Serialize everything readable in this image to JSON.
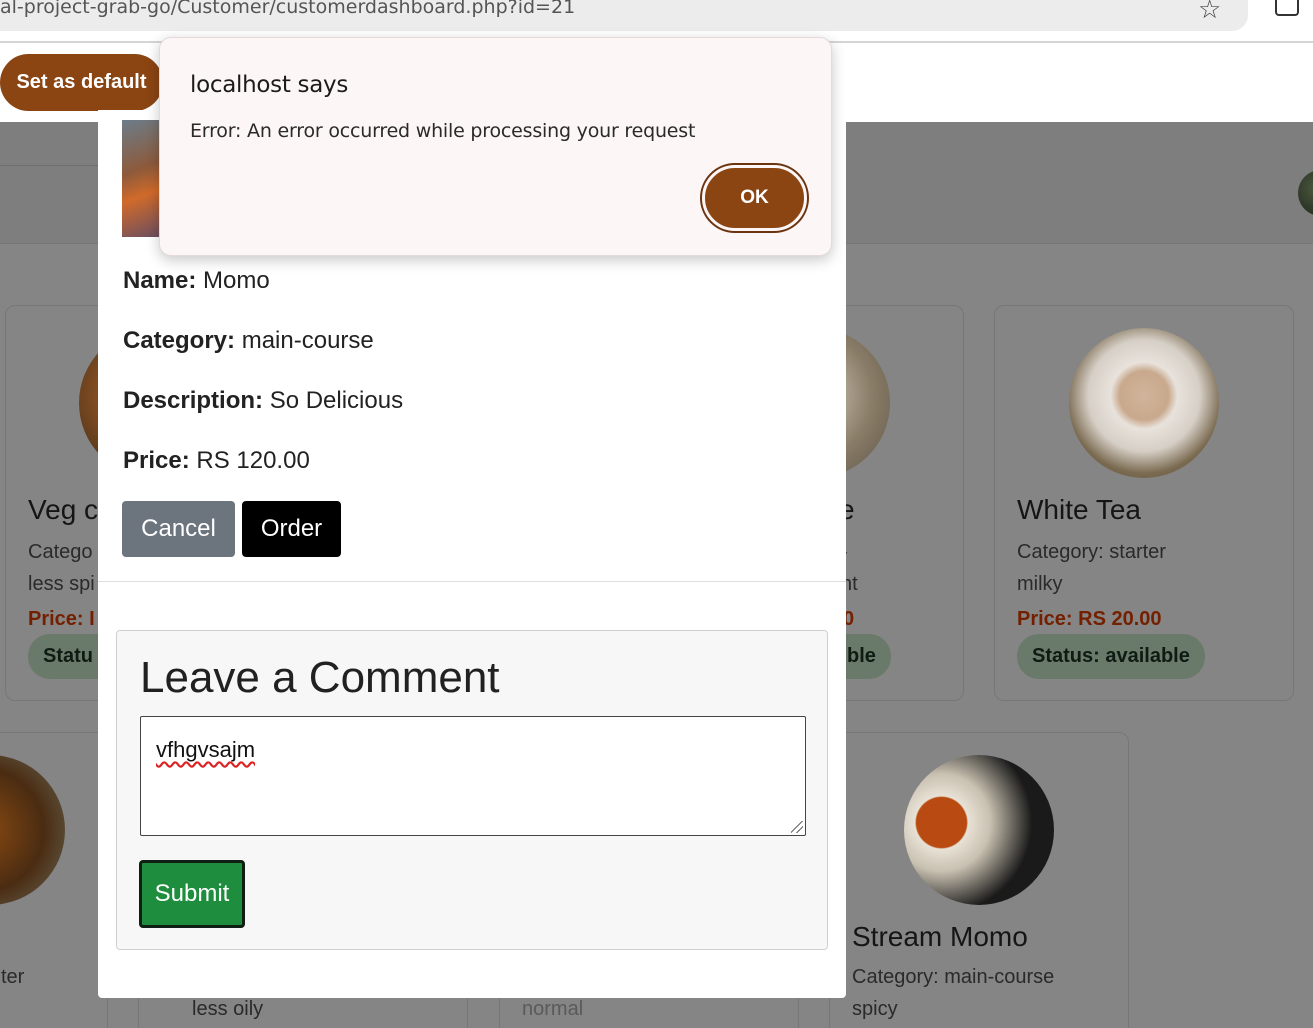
{
  "browser": {
    "url": "al-project-grab-go/Customer/customerdashboard.php?id=21",
    "set_default_label": "Set as default"
  },
  "alert": {
    "title": "localhost says",
    "message": "Error: An error occurred while processing your request",
    "ok_label": "OK"
  },
  "modal": {
    "fields": [
      {
        "label": "Name:",
        "value": "Momo"
      },
      {
        "label": "Category:",
        "value": "main-course"
      },
      {
        "label": "Description:",
        "value": "So Delicious"
      },
      {
        "label": "Price:",
        "value": "RS 120.00"
      }
    ],
    "cancel_label": "Cancel",
    "order_label": "Order",
    "comment": {
      "title": "Leave a Comment",
      "input_value": "vfhgvsajm",
      "submit_label": "Submit"
    }
  },
  "background_cards": {
    "card1": {
      "title": "Veg c",
      "category": "Catego",
      "desc": "less spi",
      "price": "Price: I",
      "status": "Statu"
    },
    "card2": {
      "title": "e",
      "category": "-",
      "desc": "nt",
      "price": "0",
      "status": "ble"
    },
    "card3": {
      "title": "White Tea",
      "category": "Category: starter",
      "desc": "milky",
      "price": "Price: RS 20.00",
      "status": "Status: available"
    },
    "card4": {
      "desc": "ter"
    },
    "card5": {
      "desc": "less oily"
    },
    "card6": {
      "desc": "normal"
    },
    "card7": {
      "title": "Stream Momo",
      "category": "Category: main-course",
      "desc": "spicy"
    }
  }
}
